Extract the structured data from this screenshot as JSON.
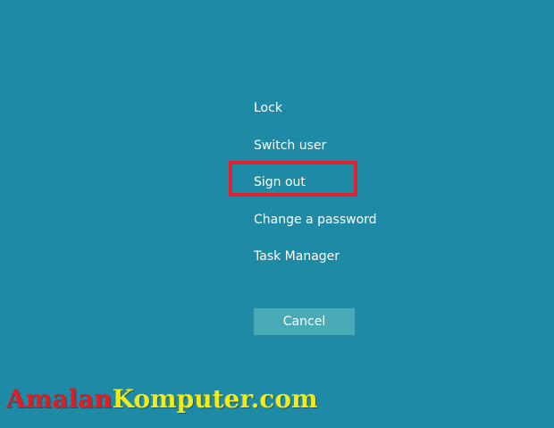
{
  "menu": {
    "items": [
      {
        "id": "lock",
        "label": "Lock"
      },
      {
        "id": "switch-user",
        "label": "Switch user"
      },
      {
        "id": "sign-out",
        "label": "Sign out"
      },
      {
        "id": "change-password",
        "label": "Change a password"
      },
      {
        "id": "task-manager",
        "label": "Task Manager"
      }
    ],
    "cancel_label": "Cancel"
  },
  "watermark": {
    "part1": "Amalan",
    "part2": "Komputer",
    "part3": ".com",
    "colors": {
      "part1": "#e31b23",
      "part2": "#f3ea1b",
      "part3": "#f3ea1b"
    }
  },
  "colors": {
    "background": "#1f8aa5",
    "highlight": "#e3202e",
    "cancel_button": "#48aab6"
  }
}
